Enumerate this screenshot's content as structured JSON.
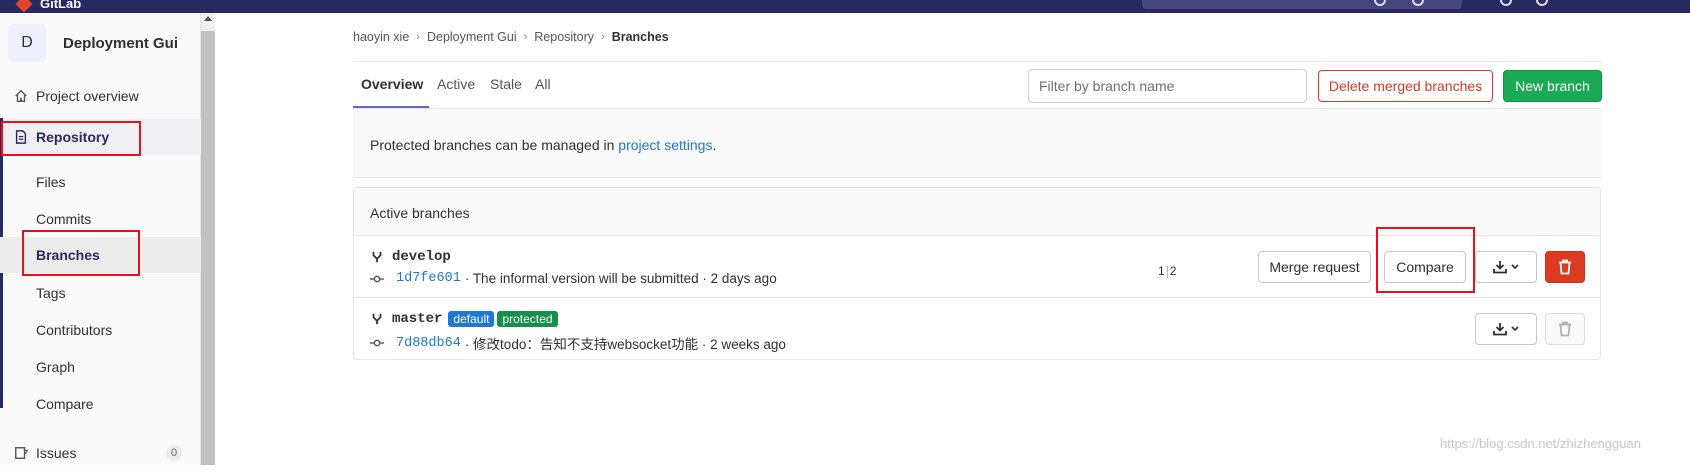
{
  "topbar": {
    "brand": "GitLab",
    "accent": "#292961",
    "logo_color": "#e24329"
  },
  "sidebar": {
    "project_initial": "D",
    "project_name": "Deployment Gui",
    "items": [
      {
        "label": "Project overview",
        "icon": "home-icon"
      },
      {
        "label": "Repository",
        "icon": "doc-icon",
        "active": true
      },
      {
        "label": "Issues",
        "icon": "issues-icon",
        "count": "0"
      }
    ],
    "repository_subitems": [
      "Files",
      "Commits",
      "Branches",
      "Tags",
      "Contributors",
      "Graph",
      "Compare"
    ],
    "current_subitem": "Branches"
  },
  "breadcrumb": [
    "haoyin xie",
    "Deployment Gui",
    "Repository",
    "Branches"
  ],
  "tabs": [
    "Overview",
    "Active",
    "Stale",
    "All"
  ],
  "active_tab": "Overview",
  "filter": {
    "placeholder": "Filter by branch name"
  },
  "actions": {
    "delete_merged": "Delete merged branches",
    "new_branch": "New branch"
  },
  "notice": {
    "text": "Protected branches can be managed in ",
    "link": "project settings",
    "suffix": "."
  },
  "panel_title": "Active branches",
  "branches": [
    {
      "name": "develop",
      "badges": [],
      "sha": "1d7fe601",
      "message": "· The informal version will be submitted · 2 days ago",
      "behind": "1",
      "ahead": "2",
      "merge_request_label": "Merge request",
      "compare_label": "Compare",
      "deletable": true
    },
    {
      "name": "master",
      "badges": [
        "default",
        "protected"
      ],
      "sha": "7d88db64",
      "message": "· 修改todo：告知不支持websocket功能 · 2 weeks ago",
      "deletable": false
    }
  ],
  "colors": {
    "link": "#1f78d1",
    "danger": "#db3b21",
    "success": "#1aaa55",
    "annotation_red": "#e6121b"
  },
  "watermark": "https://blog.csdn.net/zhizhengguan"
}
